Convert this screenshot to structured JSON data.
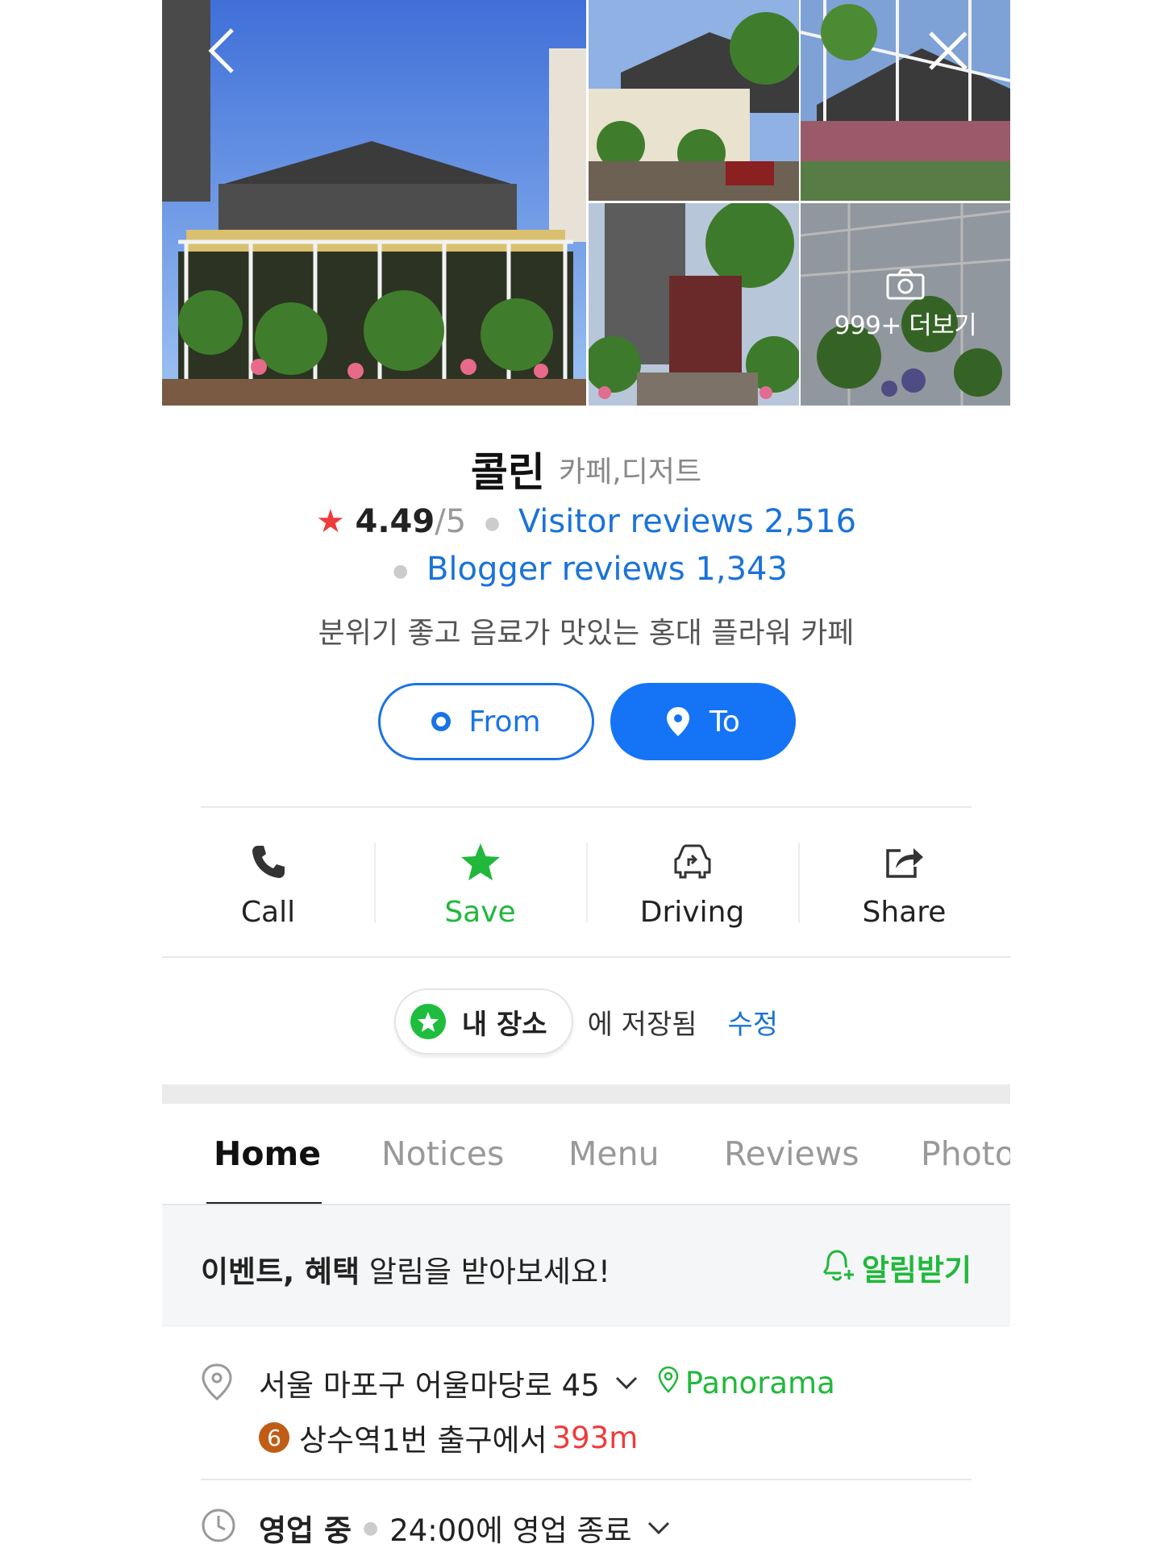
{
  "gallery": {
    "more_label": "999+ 더보기",
    "back_icon": "chevron-left-icon",
    "close_icon": "close-icon"
  },
  "place": {
    "name": "콜린",
    "category": "카페,디저트",
    "rating": "4.49",
    "rating_max": "/5",
    "visitor_reviews": "Visitor reviews 2,516",
    "blogger_reviews": "Blogger reviews 1,343",
    "description": "분위기 좋고 음료가 맛있는 홍대 플라워 카페"
  },
  "route": {
    "from_label": "From",
    "to_label": "To"
  },
  "actions": {
    "call": "Call",
    "save": "Save",
    "driving": "Driving",
    "share": "Share"
  },
  "saved": {
    "chip_label": "내 장소",
    "saved_text": "에 저장됨",
    "edit_label": "수정"
  },
  "tabs": {
    "home": "Home",
    "notices": "Notices",
    "menu": "Menu",
    "reviews": "Reviews",
    "photo": "Photo"
  },
  "banner": {
    "bold_text": "이벤트, 혜택",
    "text": " 알림을 받아보세요!",
    "button_label": "알림받기"
  },
  "address": {
    "street": "서울 마포구 어울마당로 45",
    "panorama_label": "Panorama",
    "line_number": "6",
    "station": "상수역",
    "exit_text": " 1번 출구에서 ",
    "distance": "393m"
  },
  "hours": {
    "status": "영업 중",
    "closing": "24:00에 영업 종료"
  },
  "colors": {
    "accent_blue": "#1574f5",
    "link_blue": "#1a73d8",
    "green": "#21b83b",
    "star_red": "#ef3b3b",
    "line6_badge": "#c15c16"
  }
}
